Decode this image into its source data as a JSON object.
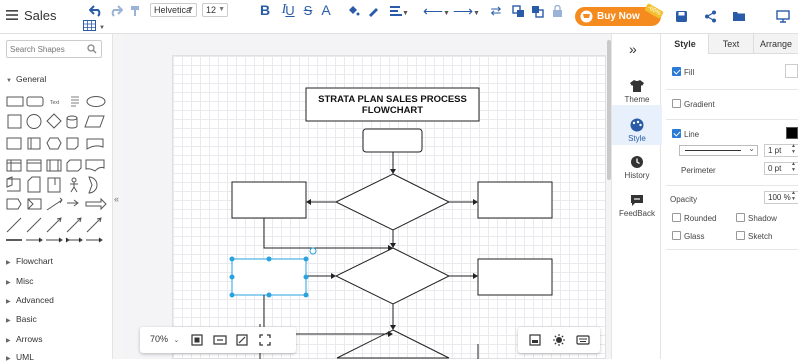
{
  "header": {
    "doc_title": "Sales",
    "font_family": "Helvetica",
    "font_size": "12",
    "buy_now": "Buy Now",
    "sale_badge": "-60%"
  },
  "sidebar": {
    "search_placeholder": "Search Shapes",
    "general": "General",
    "text_shape_label": "Text",
    "categories": [
      "Flowchart",
      "Misc",
      "Advanced",
      "Basic",
      "Arrows",
      "UML"
    ]
  },
  "diagram": {
    "title_line1": "STRATA PLAN SALES PROCESS",
    "title_line2": "FLOWCHART"
  },
  "zoom": {
    "value": "70%"
  },
  "rail": {
    "theme": "Theme",
    "style": "Style",
    "history": "History",
    "feedback": "FeedBack"
  },
  "props": {
    "tabs": [
      "Style",
      "Text",
      "Arrange"
    ],
    "fill": "Fill",
    "gradient": "Gradient",
    "line": "Line",
    "line_width": "1 pt",
    "perimeter": "Perimeter",
    "perimeter_value": "0 pt",
    "opacity": "Opacity",
    "opacity_value": "100 %",
    "rounded": "Rounded",
    "shadow": "Shadow",
    "glass": "Glass",
    "sketch": "Sketch"
  },
  "colors": {
    "accent": "#2a5ba8",
    "buy_now_bg": "#f58a1f",
    "selection": "#29a3e0"
  }
}
